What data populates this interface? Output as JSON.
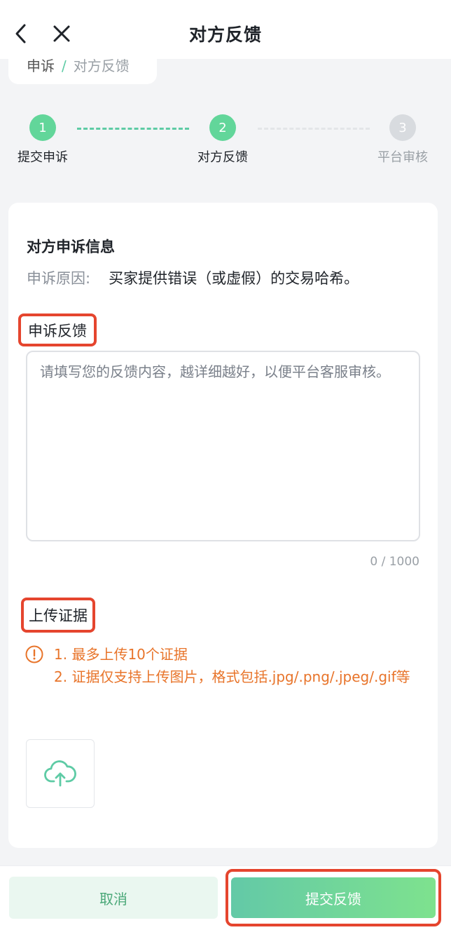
{
  "header": {
    "title": "对方反馈",
    "back_icon": "chevron-left-icon",
    "close_icon": "close-icon"
  },
  "breadcrumb": {
    "first": "申诉",
    "separator": "/",
    "current": "对方反馈"
  },
  "steps": [
    {
      "number": "1",
      "label": "提交申诉",
      "state": "done"
    },
    {
      "number": "2",
      "label": "对方反馈",
      "state": "current"
    },
    {
      "number": "3",
      "label": "平台审核",
      "state": "pending"
    }
  ],
  "appeal_info": {
    "title": "对方申诉信息",
    "reason_label": "申诉原因:",
    "reason_value": "买家提供错误（或虚假）的交易哈希。"
  },
  "feedback": {
    "label": "申诉反馈",
    "placeholder": "请填写您的反馈内容，越详细越好，以便平台客服审核。",
    "counter": "0 / 1000"
  },
  "evidence": {
    "label": "上传证据",
    "tip_line1": "1. 最多上传10个证据",
    "tip_line2": "2. 证据仅支持上传图片，格式包括.jpg/.png/.jpeg/.gif等",
    "upload_icon": "cloud-upload-icon"
  },
  "footer": {
    "cancel_label": "取消",
    "submit_label": "提交反馈"
  },
  "colors": {
    "accent": "#62d69a",
    "highlight": "#e5452e",
    "warning": "#e8742a"
  }
}
